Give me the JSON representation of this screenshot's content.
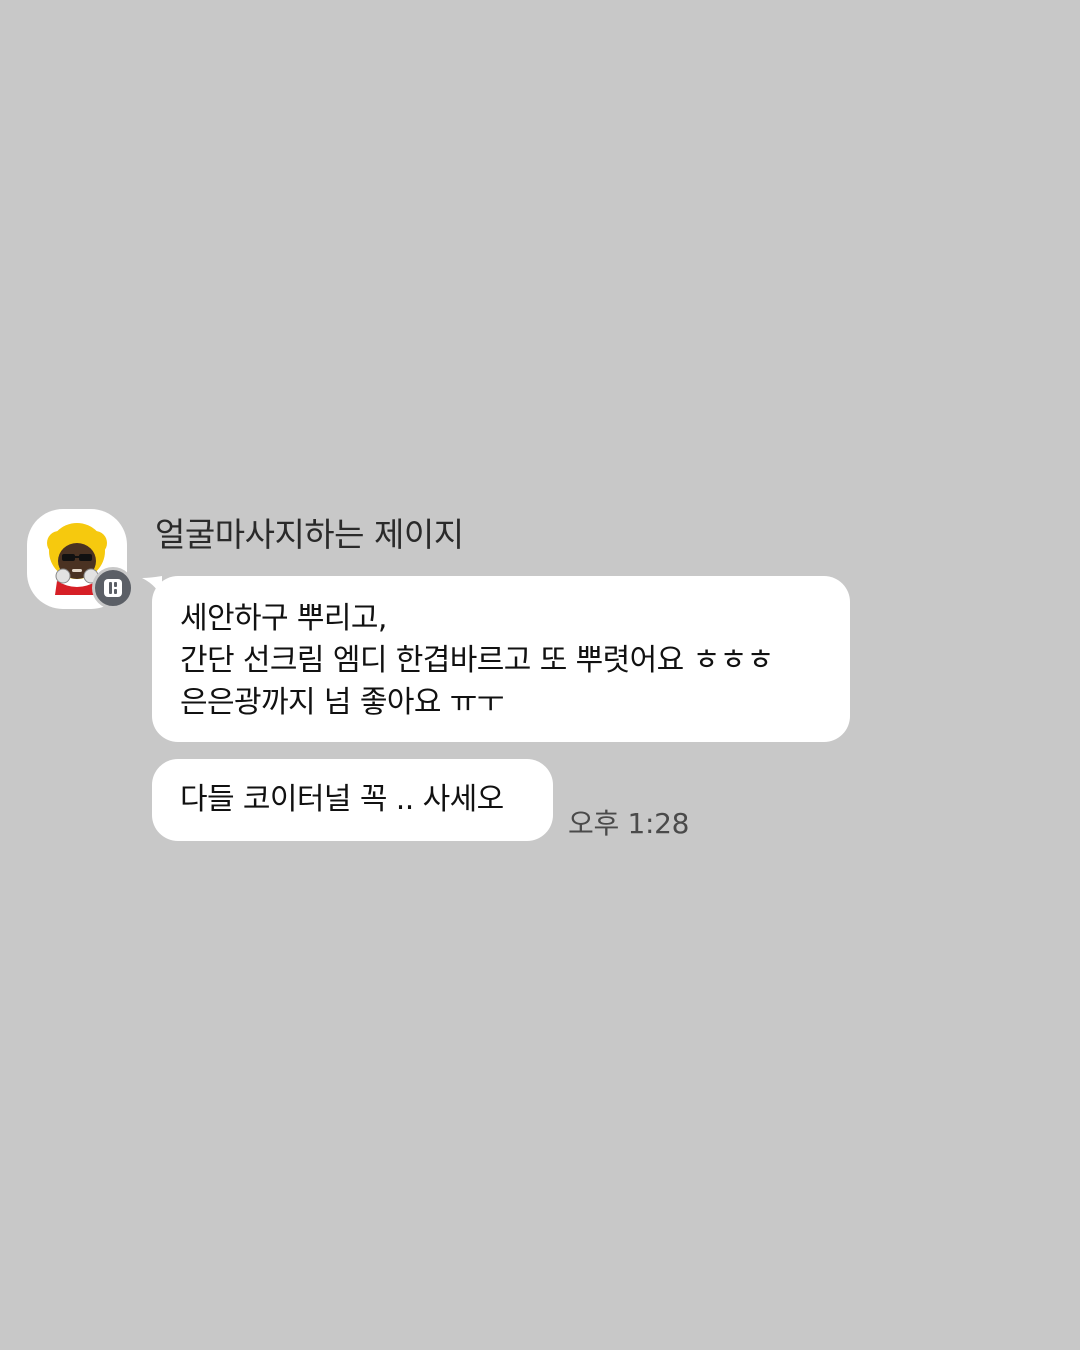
{
  "chat": {
    "sender_name": "얼굴마사지하는 제이지",
    "avatar_icon": "character-avatar-icon",
    "badge_icon": "profile-badge-icon",
    "messages": [
      {
        "lines": [
          "세안하구 뿌리고,",
          "간단 선크림 엠디 한겹바르고 또 뿌렷어요 ㅎㅎㅎ",
          "은은광까지 넘 좋아요 ㅠㅜ"
        ]
      },
      {
        "lines": [
          "다들 코이터널 꼭 .. 사세오"
        ]
      }
    ],
    "timestamp": "오후 1:28"
  },
  "colors": {
    "background": "#c8c8c8",
    "bubble": "#ffffff",
    "badge": "#5b5f66"
  }
}
